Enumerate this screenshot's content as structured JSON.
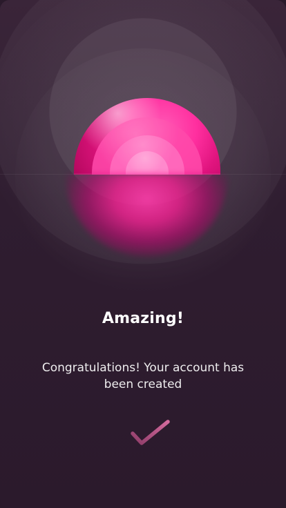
{
  "screen": {
    "title": "Amazing!",
    "message": "Congratulations! Your account has been created"
  },
  "icons": {
    "illustration": "success-illustration",
    "confirm": "checkmark-icon"
  },
  "colors": {
    "background": "#2B1A2C",
    "accent_pink": "#FF2F9F",
    "accent_light_pink": "#FF8CCD",
    "text": "#FFFFFF",
    "check_gradient_start": "#8E3C68",
    "check_gradient_end": "#D36A9D"
  }
}
